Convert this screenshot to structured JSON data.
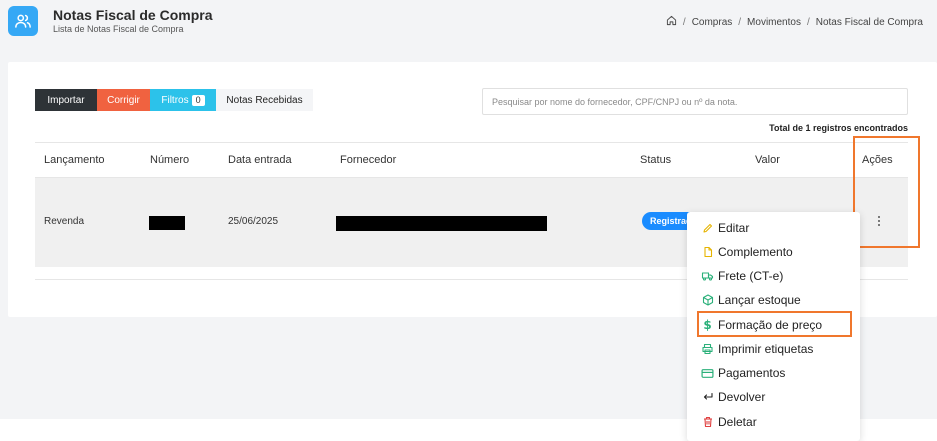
{
  "header": {
    "title": "Notas Fiscal de Compra",
    "subtitle": "Lista de Notas Fiscal de Compra",
    "icon": "users-icon",
    "icon_color": "#35a8f5"
  },
  "breadcrumb": {
    "items": [
      "Compras",
      "Movimentos",
      "Notas Fiscal de Compra"
    ],
    "separator": "/"
  },
  "toolbar": {
    "importar": "Importar",
    "corrigir": "Corrigir",
    "filtros": "Filtros",
    "filtros_count": "0",
    "recebidas": "Notas Recebidas",
    "colors": {
      "importar": "#2e3337",
      "corrigir": "#f06240",
      "filtros": "#2cc2ea",
      "recebidas": "#f4f5f7"
    }
  },
  "search": {
    "placeholder": "Pesquisar por nome do fornecedor, CPF/CNPJ ou nº da nota.",
    "value": ""
  },
  "total_text": "Total de 1 registros encontrados",
  "table": {
    "columns": [
      "Lançamento",
      "Número",
      "Data entrada",
      "Fornecedor",
      "Status",
      "Valor",
      "Ações"
    ],
    "rows": [
      {
        "lancamento": "Revenda",
        "numero": "",
        "data_entrada": "25/06/2025",
        "fornecedor": "",
        "status": "Registrada",
        "valor": ""
      }
    ]
  },
  "status_color": "#1a8cff",
  "dropdown": {
    "items": [
      {
        "label": "Editar",
        "icon": "pencil-icon",
        "color": "#e6b400"
      },
      {
        "label": "Complemento",
        "icon": "file-icon",
        "color": "#e6b400"
      },
      {
        "label": "Frete (CT-e)",
        "icon": "truck-icon",
        "color": "#2bb07a"
      },
      {
        "label": "Lançar estoque",
        "icon": "box-icon",
        "color": "#2bb07a"
      },
      {
        "label": "Formação de preço",
        "icon": "dollar-icon",
        "color": "#2bb07a"
      },
      {
        "label": "Imprimir etiquetas",
        "icon": "printer-icon",
        "color": "#2bb07a"
      },
      {
        "label": "Pagamentos",
        "icon": "card-icon",
        "color": "#2bb07a"
      },
      {
        "label": "Devolver",
        "icon": "return-icon",
        "color": "#222222"
      },
      {
        "label": "Deletar",
        "icon": "trash-icon",
        "color": "#e04040"
      }
    ]
  },
  "highlight_color": "#f0772d"
}
